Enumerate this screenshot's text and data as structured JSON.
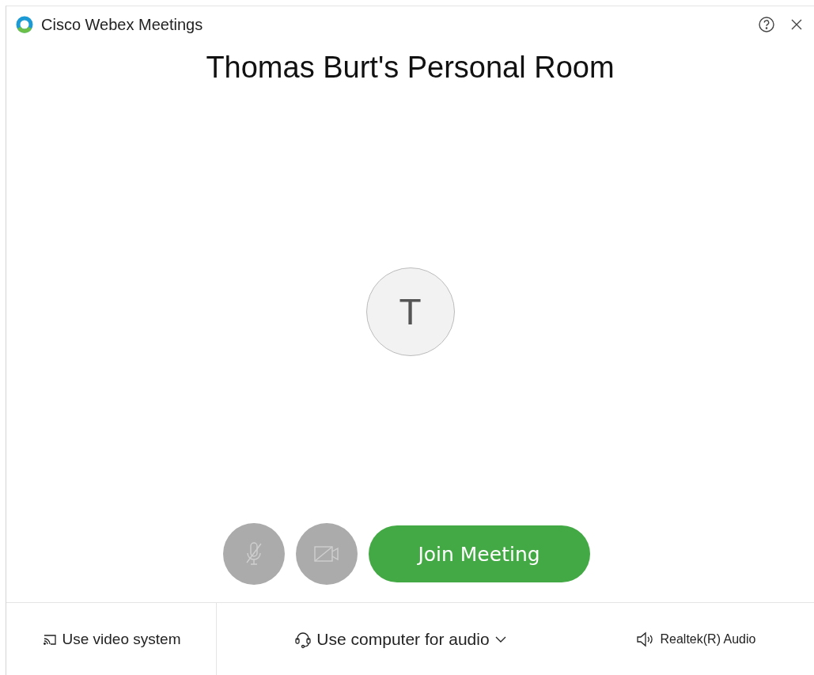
{
  "window": {
    "title": "Cisco Webex Meetings"
  },
  "heading": "Thomas Burt's Personal Room",
  "avatar": {
    "initial": "T"
  },
  "controls": [
    {
      "kind": "mic",
      "disabled": true
    },
    {
      "kind": "video",
      "disabled": true
    }
  ],
  "join_button": "Join Meeting",
  "footer": {
    "video_system": "Use video system",
    "audio": "Use computer for audio",
    "speaker": "Realtek(R) Audio"
  }
}
